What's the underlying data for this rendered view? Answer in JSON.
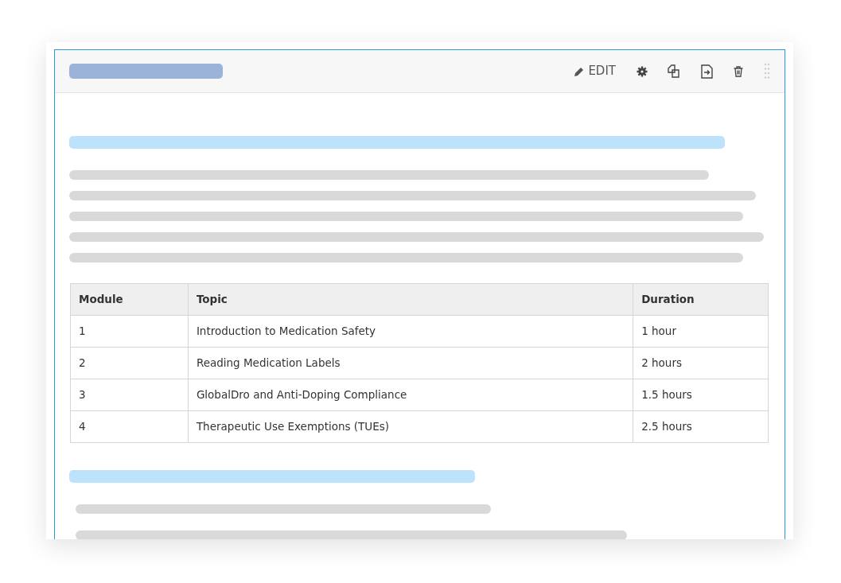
{
  "toolbar": [
    {
      "kind": "edit",
      "label": "EDIT"
    },
    {
      "kind": "settings"
    },
    {
      "kind": "duplicate"
    },
    {
      "kind": "export"
    },
    {
      "kind": "delete"
    },
    {
      "kind": "drag"
    }
  ],
  "table": {
    "columns": [
      "Module",
      "Topic",
      "Duration"
    ],
    "rows": [
      [
        "1",
        "Introduction to Medication Safety",
        "1 hour"
      ],
      [
        "2",
        "Reading Medication Labels",
        "2 hours"
      ],
      [
        "3",
        "GlobalDro and Anti-Doping Compliance",
        "1.5 hours"
      ],
      [
        "4",
        "Therapeutic Use Exemptions (TUEs)",
        "2.5 hours"
      ]
    ]
  }
}
